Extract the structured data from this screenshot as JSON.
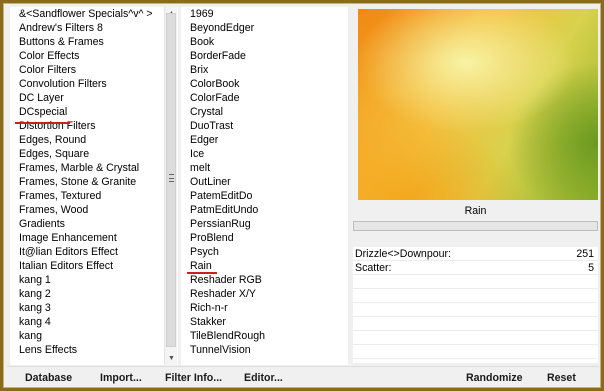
{
  "categories": {
    "items": [
      "&<Sandflower Specials^v^ >",
      "Andrew's Filters 8",
      "Buttons & Frames",
      "Color Effects",
      "Color Filters",
      "Convolution Filters",
      "DC Layer",
      "DCspecial",
      "Distortion Filters",
      "Edges, Round",
      "Edges, Square",
      "Frames, Marble & Crystal",
      "Frames, Stone & Granite",
      "Frames, Textured",
      "Frames, Wood",
      "Gradients",
      "Image Enhancement",
      "It@lian Editors Effect",
      "Italian Editors Effect",
      "kang 1",
      "kang 2",
      "kang 3",
      "kang 4",
      "kang",
      "Lens Effects"
    ],
    "selected": "DCspecial"
  },
  "filters": {
    "items": [
      "1969",
      "BeyondEdger",
      "Book",
      "BorderFade",
      "Brix",
      "ColorBook",
      "ColorFade",
      "Crystal",
      "DuoTrast",
      "Edger",
      "Ice",
      "melt",
      "OutLiner",
      "PatemEditDo",
      "PatmEditUndo",
      "PerssianRug",
      "ProBlend",
      "Psych",
      "Rain",
      "Reshader RGB",
      "Reshader X/Y",
      "Rich-n-r",
      "Stakker",
      "TileBlendRough",
      "TunnelVision"
    ],
    "selected": "Rain"
  },
  "filter_name": "Rain",
  "params": [
    {
      "label": "Drizzle<>Downpour:",
      "value": "251"
    },
    {
      "label": "Scatter:",
      "value": "5"
    }
  ],
  "buttons": {
    "database": "Database",
    "import": "Import...",
    "filter_info": "Filter Info...",
    "editor": "Editor...",
    "randomize": "Randomize",
    "reset": "Reset"
  },
  "icons": {
    "scroll_up": "scroll-up-arrow-icon",
    "scroll_down": "scroll-down-arrow-icon"
  },
  "colors": {
    "frame": "#8a6a1c",
    "highlight_underline": "#cc2020"
  }
}
